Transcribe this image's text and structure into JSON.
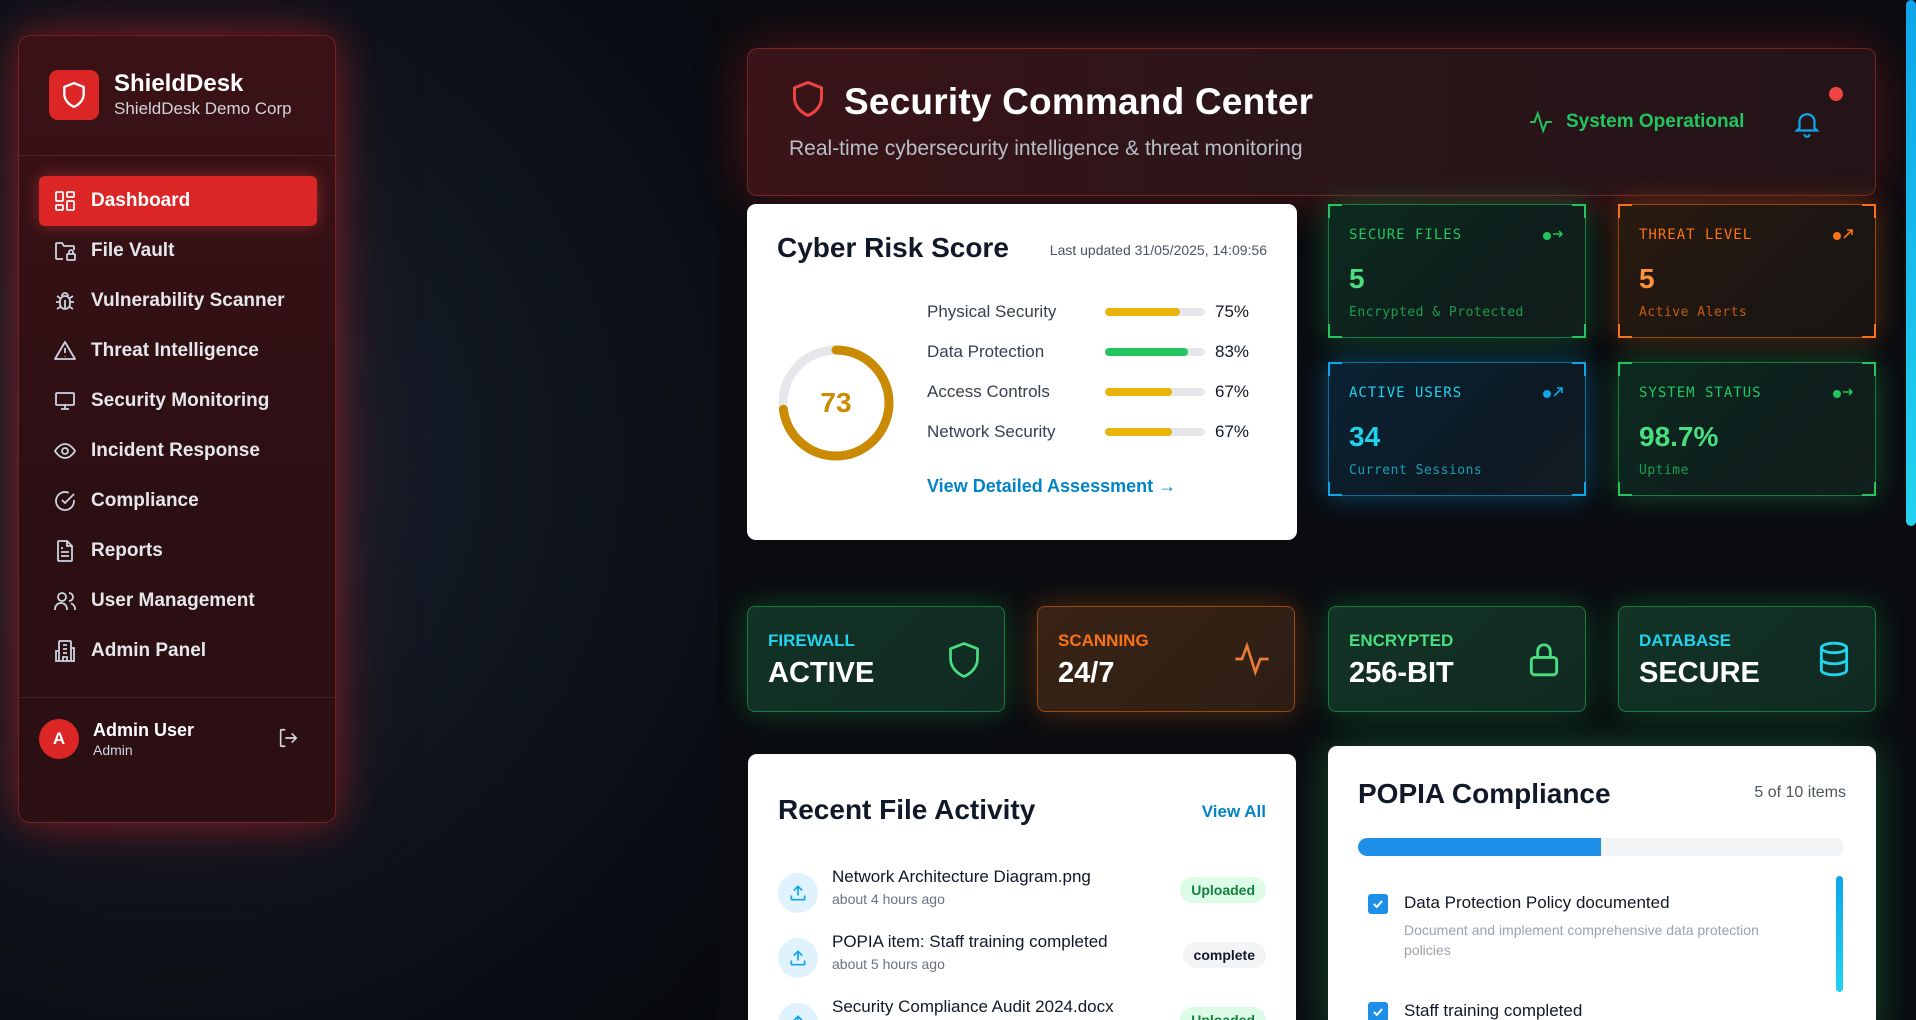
{
  "brand": {
    "name": "ShieldDesk",
    "org": "ShieldDesk Demo Corp"
  },
  "sidebar": {
    "items": [
      {
        "label": "Dashboard",
        "icon": "dashboard-icon",
        "active": true
      },
      {
        "label": "File Vault",
        "icon": "folder-lock-icon"
      },
      {
        "label": "Vulnerability Scanner",
        "icon": "bug-icon"
      },
      {
        "label": "Threat Intelligence",
        "icon": "alert-triangle-icon"
      },
      {
        "label": "Security Monitoring",
        "icon": "monitor-icon"
      },
      {
        "label": "Incident Response",
        "icon": "eye-icon"
      },
      {
        "label": "Compliance",
        "icon": "check-circle-icon"
      },
      {
        "label": "Reports",
        "icon": "file-text-icon"
      },
      {
        "label": "User Management",
        "icon": "users-icon"
      },
      {
        "label": "Admin Panel",
        "icon": "building-icon"
      }
    ]
  },
  "user": {
    "initial": "A",
    "name": "Admin User",
    "role": "Admin"
  },
  "header": {
    "title": "Security Command Center",
    "subtitle": "Real-time cybersecurity intelligence & threat monitoring",
    "status": "System Operational"
  },
  "risk": {
    "title": "Cyber Risk Score",
    "updated": "Last updated 31/05/2025, 14:09:56",
    "score": "73",
    "score_value": 73,
    "metrics": [
      {
        "label": "Physical Security",
        "pct": "75%",
        "value": 75,
        "color": "#eab308"
      },
      {
        "label": "Data Protection",
        "pct": "83%",
        "value": 83,
        "color": "#22c55e"
      },
      {
        "label": "Access Controls",
        "pct": "67%",
        "value": 67,
        "color": "#eab308"
      },
      {
        "label": "Network Security",
        "pct": "67%",
        "value": 67,
        "color": "#eab308"
      }
    ],
    "link": "View Detailed Assessment →"
  },
  "tiles": [
    {
      "label": "SECURE FILES",
      "value": "5",
      "sub": "Encrypted & Protected"
    },
    {
      "label": "THREAT LEVEL",
      "value": "5",
      "sub": "Active Alerts"
    },
    {
      "label": "ACTIVE USERS",
      "value": "34",
      "sub": "Current Sessions"
    },
    {
      "label": "SYSTEM STATUS",
      "value": "98.7%",
      "sub": "Uptime"
    }
  ],
  "status_cards": [
    {
      "label": "FIREWALL",
      "value": "ACTIVE",
      "label_color": "#22d3ee",
      "icon": "shield-icon"
    },
    {
      "label": "SCANNING",
      "value": "24/7",
      "label_color": "#f97316",
      "icon": "activity-icon"
    },
    {
      "label": "ENCRYPTED",
      "value": "256-BIT",
      "label_color": "#4ade80",
      "icon": "lock-icon"
    },
    {
      "label": "DATABASE",
      "value": "SECURE",
      "label_color": "#22d3ee",
      "icon": "database-icon"
    }
  ],
  "activity": {
    "title": "Recent File Activity",
    "view_all": "View All",
    "items": [
      {
        "name": "Network Architecture Diagram.png",
        "time": "about 4 hours ago",
        "badge": "Uploaded"
      },
      {
        "name": "POPIA item: Staff training completed",
        "time": "about 5 hours ago",
        "badge": "complete"
      },
      {
        "name": "Security Compliance Audit 2024.docx",
        "time": "",
        "badge": "Uploaded"
      }
    ]
  },
  "popia": {
    "title": "POPIA Compliance",
    "count": "5 of 10 items",
    "progress": 0.5,
    "items": [
      {
        "title": "Data Protection Policy documented",
        "desc": "Document and implement comprehensive data protection policies"
      },
      {
        "title": "Staff training completed",
        "desc": ""
      }
    ]
  },
  "colors": {
    "accent": "#dc2626",
    "success": "#22c55e",
    "warning": "#f97316",
    "info": "#0ea5e9"
  }
}
